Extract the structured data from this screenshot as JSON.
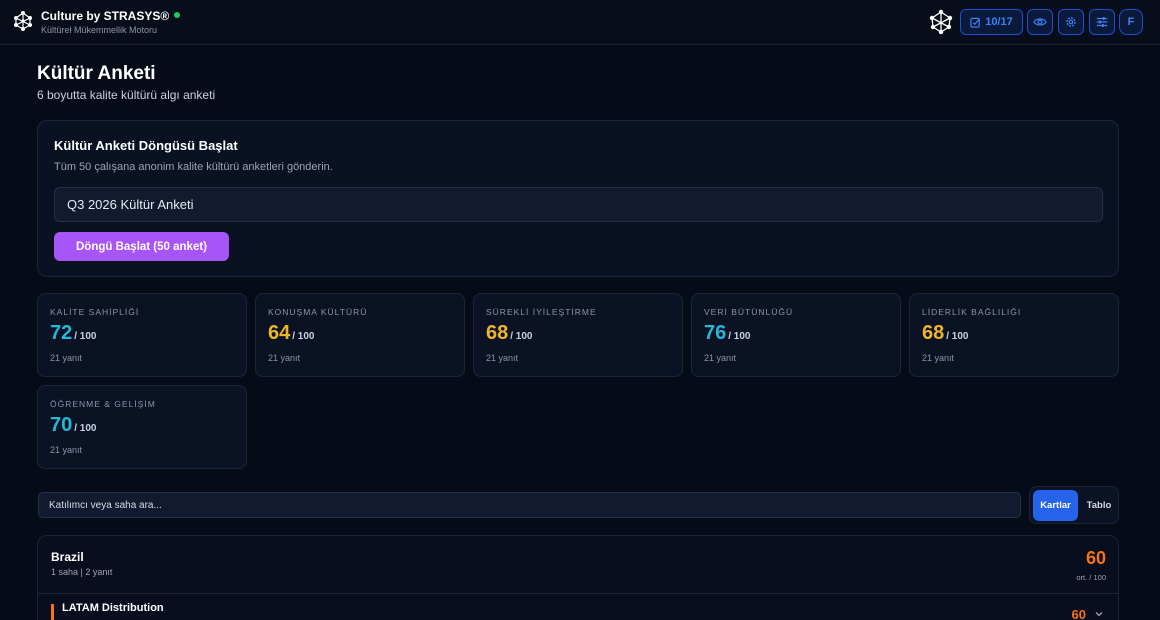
{
  "app": {
    "brand": "Culture by STRASYS®",
    "subtitle": "Kültürel Mükemmellik Motoru",
    "progress": "10/17",
    "avatar_initial": "F",
    "online_color": "#22c55e"
  },
  "page": {
    "title": "Kültür Anketi",
    "subtitle": "6 boyutta kalite kültürü algı anketi"
  },
  "cycle": {
    "title": "Kültür Anketi Döngüsü Başlat",
    "description": "Tüm 50 çalışana anonim kalite kültürü anketleri gönderin.",
    "input_value": "Q3 2026 Kültür Anketi",
    "button_label": "Döngü Başlat (50 anket)",
    "button_color": "#a855f7"
  },
  "dimensions": [
    {
      "label": "KALİTE SAHİPLİĞİ",
      "score": "72",
      "max": "/ 100",
      "responses": "21 yanıt",
      "color": "#22b8d6"
    },
    {
      "label": "KONUŞMA KÜLTÜRÜ",
      "score": "64",
      "max": "/ 100",
      "responses": "21 yanıt",
      "color": "#f0b429"
    },
    {
      "label": "SÜREKLİ İYİLEŞTİRME",
      "score": "68",
      "max": "/ 100",
      "responses": "21 yanıt",
      "color": "#f0b429"
    },
    {
      "label": "VERİ BÜTÜNLÜĞÜ",
      "score": "76",
      "max": "/ 100",
      "responses": "21 yanıt",
      "color": "#22b8d6"
    },
    {
      "label": "LİDERLİK BAĞLILIĞI",
      "score": "68",
      "max": "/ 100",
      "responses": "21 yanıt",
      "color": "#f0b429"
    },
    {
      "label": "ÖĞRENME & GELİŞİM",
      "score": "70",
      "max": "/ 100",
      "responses": "21 yanıt",
      "color": "#22b8d6"
    }
  ],
  "search": {
    "placeholder": "Katılımcı veya saha ara..."
  },
  "view_toggle": {
    "cards_label": "Kartlar",
    "table_label": "Tablo",
    "selected": "Kartlar"
  },
  "regions": [
    {
      "name": "Brazil",
      "meta": "1 saha | 2 yanıt",
      "score": "60",
      "avg_label": "ort. / 100",
      "sites": [
        {
          "name": "LATAM Distribution",
          "score": "60"
        }
      ]
    }
  ]
}
